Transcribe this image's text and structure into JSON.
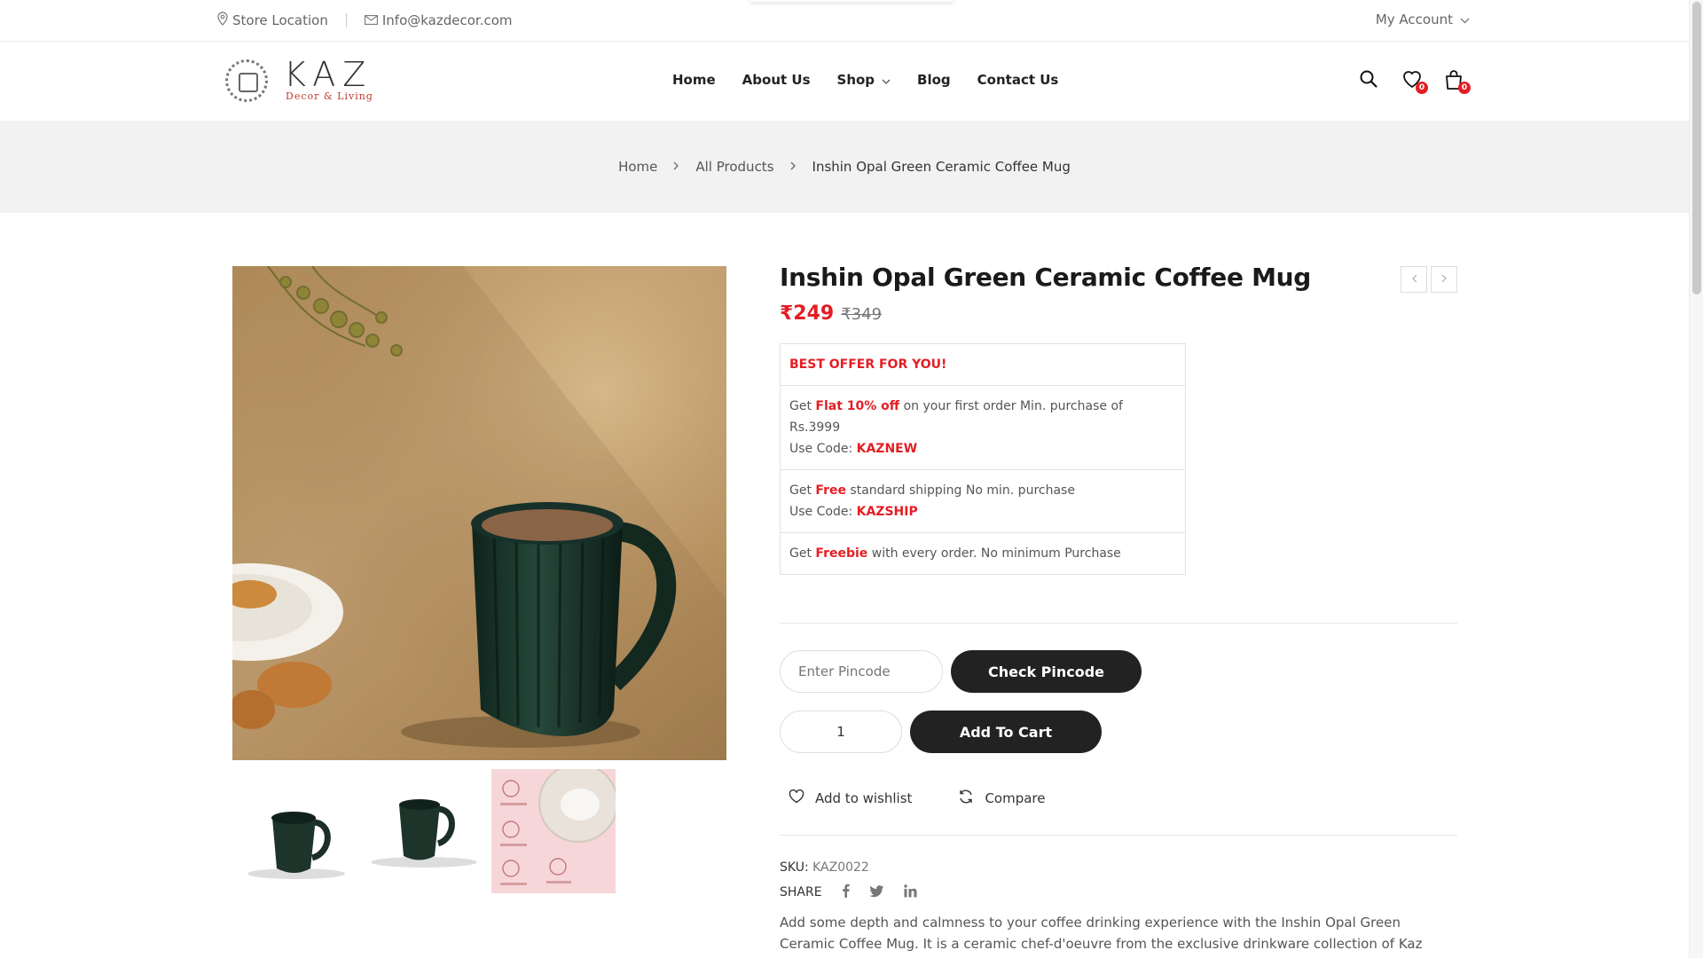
{
  "topbar": {
    "store_location": "Store Location",
    "email": "Info@kazdecor.com",
    "account": "My Account"
  },
  "header": {
    "logo_big": "KAZ",
    "logo_small": "Decor & Living",
    "nav": [
      "Home",
      "About Us",
      "Shop",
      "Blog",
      "Contact Us"
    ],
    "wishlist_count": "0",
    "cart_count": "0"
  },
  "breadcrumb": [
    "Home",
    "All Products",
    "Inshin Opal Green Ceramic Coffee Mug"
  ],
  "product": {
    "title": "Inshin Opal Green Ceramic Coffee Mug",
    "price": "₹249",
    "old_price": "₹349",
    "offers_heading": "BEST OFFER FOR YOU!",
    "offers": [
      {
        "pre": "Get ",
        "highlight": "Flat 10% off",
        "post": " on your first order Min. purchase of Rs.3999",
        "code_label": "Use Code: ",
        "code": "KAZNEW"
      },
      {
        "pre": "Get ",
        "highlight": "Free",
        "post": " standard shipping No min. purchase",
        "code_label": "Use Code: ",
        "code": "KAZSHIP"
      },
      {
        "pre": "Get ",
        "highlight": "Freebie",
        "post": " with every order. No minimum Purchase"
      }
    ],
    "pincode_placeholder": "Enter Pincode",
    "check_pincode": "Check Pincode",
    "quantity": "1",
    "add_to_cart": "Add To Cart",
    "wishlist": "Add to wishlist",
    "compare": "Compare",
    "sku_label": "SKU:",
    "sku": "KAZ0022",
    "share_label": "SHARE",
    "description": "Add some depth and calmness to your coffee drinking experience with the Inshin Opal Green Ceramic Coffee Mug. It is a ceramic chef-d'oeuvre from the exclusive drinkware collection of Kaz Décor & Living. It features a pottery style with a hint of ancient Greek kingdom aesthetics. Design is also commendably"
  },
  "colors": {
    "accent_red": "#e31e24",
    "dark_button": "#222222",
    "mug_green": "#1e3b30"
  }
}
